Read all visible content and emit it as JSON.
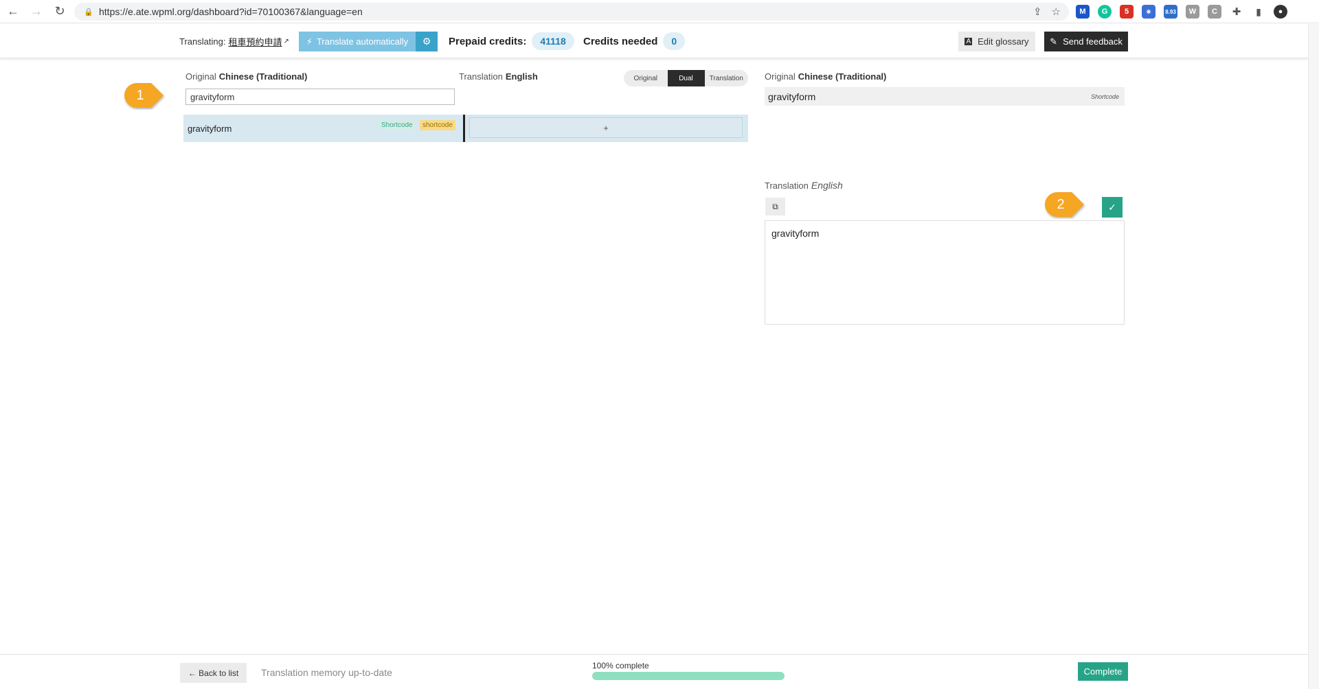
{
  "browser": {
    "url": "https://e.ate.wpml.org/dashboard?id=70100367&language=en",
    "extensions": [
      {
        "name": "m",
        "color": "#1a56c7",
        "label": "M"
      },
      {
        "name": "g",
        "color": "#15c39a",
        "label": "G"
      },
      {
        "name": "r",
        "color": "#d93025",
        "label": "5"
      },
      {
        "name": "s",
        "color": "#3b6fd6",
        "label": "✷"
      },
      {
        "name": "b",
        "color": "#2f6fc9",
        "label": "8.93"
      },
      {
        "name": "w",
        "color": "#9a9a9a",
        "label": "W"
      },
      {
        "name": "c",
        "color": "#9a9a9a",
        "label": "C"
      }
    ]
  },
  "header": {
    "translating_label": "Translating:",
    "translating_doc": "租車預約申請",
    "translate_auto_label": "Translate automatically",
    "prepaid_label": "Prepaid credits:",
    "prepaid_value": "41118",
    "needed_label": "Credits needed",
    "needed_value": "0",
    "glossary_label": "Edit glossary",
    "feedback_label": "Send feedback",
    "auto_btn_color": "#7ec3e3",
    "gear_btn_color": "#3aa3c9"
  },
  "editor": {
    "original_label": "Original",
    "original_lang": "Chinese (Traditional)",
    "translation_label": "Translation",
    "translation_lang": "English",
    "search_value": "gravityform",
    "view_modes": [
      "Original",
      "Dual",
      "Translation"
    ],
    "active_view": "Dual",
    "row": {
      "text": "gravityform",
      "tag1": "Shortcode",
      "tag2": "shortcode",
      "add_symbol": "+"
    }
  },
  "panel": {
    "original_label": "Original",
    "original_lang": "Chinese (Traditional)",
    "original_text": "gravityform",
    "original_tag": "Shortcode",
    "translation_label": "Translation",
    "translation_lang": "English",
    "translation_text": "gravityform",
    "accent_color": "#27a487"
  },
  "callouts": [
    {
      "number": "1",
      "color": "#f5a623"
    },
    {
      "number": "2",
      "color": "#f5a623"
    }
  ],
  "footer": {
    "back_label": "← Back to list",
    "memory_status": "Translation memory up-to-date",
    "progress_label": "100% complete",
    "progress_value": 100,
    "complete_label": "Complete"
  }
}
